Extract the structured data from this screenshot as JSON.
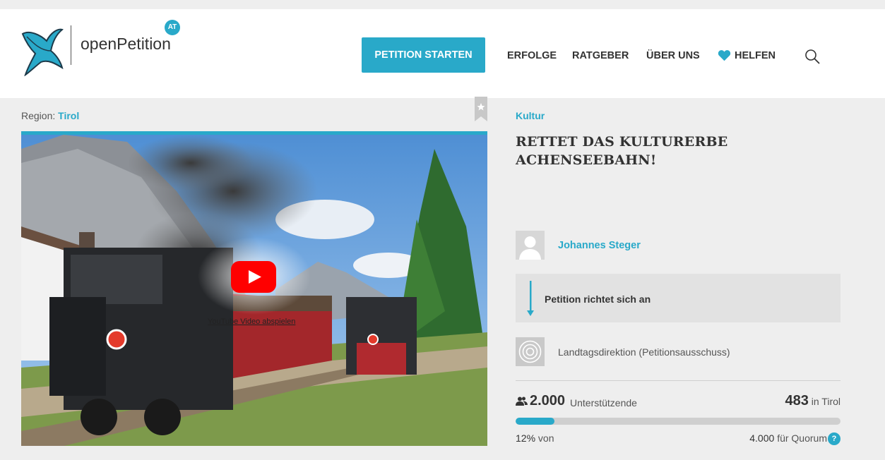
{
  "brand": {
    "name": "openPetition",
    "country_badge": "AT",
    "accent_color": "#29a9c9"
  },
  "nav": {
    "start_label": "PETITION STARTEN",
    "items": [
      "ERFOLGE",
      "RATGEBER",
      "ÜBER UNS"
    ],
    "help_label": "HELFEN"
  },
  "petition": {
    "region_prefix": "Region:",
    "region": "Tirol",
    "category": "Kultur",
    "title": "RETTET DAS KULTURERBE ACHENSEEBAHN!",
    "video_label": "YouTube Video abspielen",
    "author": "Johannes Steger",
    "addressed_label": "Petition richtet sich an",
    "recipient": "Landtagsdirektion (Petitionsausschuss)"
  },
  "stats": {
    "supporters": "2.000",
    "supporters_label": "Unterstützende",
    "regional_count": "483",
    "regional_label": "in Tirol",
    "progress_percent": 12,
    "percent_text": "12%",
    "percent_suffix": "von",
    "quorum": "4.000",
    "quorum_label": "für Quorum",
    "help_mark": "?"
  }
}
